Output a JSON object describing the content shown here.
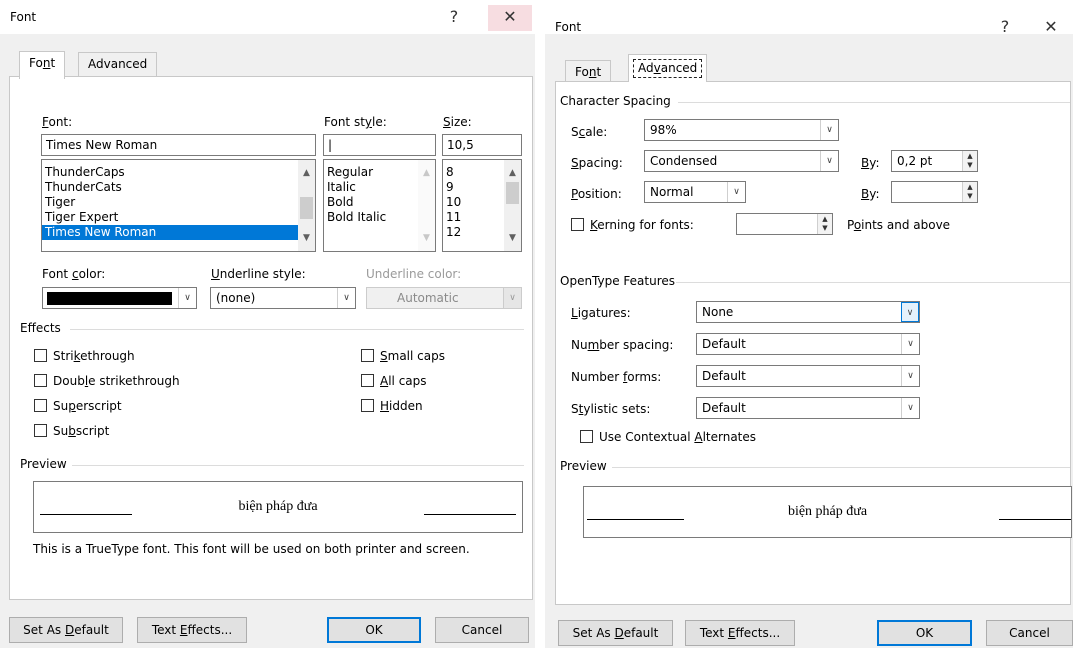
{
  "left_dialog": {
    "title": "Font",
    "help_label": "?",
    "close_label": "✕",
    "tabs": [
      {
        "prefix": "Fo",
        "mnemonic": "n",
        "suffix": "t"
      },
      {
        "label": "Advanced"
      }
    ],
    "font_label": {
      "mnemonic": "F",
      "rest": "ont:"
    },
    "font_value": "Times New Roman",
    "font_list": [
      "ThunderCaps",
      "ThunderCats",
      "Tiger",
      "Tiger Expert",
      "Times New Roman"
    ],
    "style_label": {
      "prefix": "Font st",
      "mnemonic": "y",
      "suffix": "le:"
    },
    "style_value": "|",
    "style_list": [
      "Regular",
      "Italic",
      "Bold",
      "Bold Italic"
    ],
    "size_label": {
      "mnemonic": "S",
      "rest": "ize:"
    },
    "size_value": "10,5",
    "size_list": [
      "8",
      "9",
      "10",
      "11",
      "12"
    ],
    "font_color_label": {
      "prefix": "Font ",
      "mnemonic": "c",
      "suffix": "olor:"
    },
    "font_color": "#000000",
    "underline_style_label": {
      "mnemonic": "U",
      "rest": "nderline style:"
    },
    "underline_style_value": "(none)",
    "underline_color_label": "Underline color:",
    "underline_color_value": "Automatic",
    "effects_label": "Effects",
    "effects": [
      {
        "prefix": "Stri",
        "mnemonic": "k",
        "suffix": "ethrough",
        "checked": false
      },
      {
        "prefix": "Doub",
        "mnemonic": "l",
        "suffix": "e strikethrough",
        "checked": false
      },
      {
        "prefix": "Su",
        "mnemonic": "p",
        "suffix": "erscript",
        "checked": false
      },
      {
        "prefix": "Su",
        "mnemonic": "b",
        "suffix": "script",
        "checked": false
      },
      {
        "prefix": "",
        "mnemonic": "S",
        "suffix": "mall caps",
        "checked": false
      },
      {
        "prefix": "",
        "mnemonic": "A",
        "suffix": "ll caps",
        "checked": false
      },
      {
        "prefix": "",
        "mnemonic": "H",
        "suffix": "idden",
        "checked": false
      }
    ],
    "preview_label": "Preview",
    "preview_text": "biện pháp đưa",
    "truetype_note": "This is a TrueType font. This font will be used on both printer and screen.",
    "buttons": {
      "set_default": {
        "prefix": "Set As ",
        "mnemonic": "D",
        "suffix": "efault"
      },
      "text_effects": {
        "prefix": "Text ",
        "mnemonic": "E",
        "suffix": "ffects..."
      },
      "ok": "OK",
      "cancel": "Cancel"
    }
  },
  "right_dialog": {
    "title": "Font",
    "help_label": "?",
    "close_label": "✕",
    "tabs": [
      {
        "prefix": "Fo",
        "mnemonic": "n",
        "suffix": "t"
      },
      {
        "prefix": "Ad",
        "mnemonic": "v",
        "suffix": "anced"
      }
    ],
    "character_spacing_label": "Character Spacing",
    "scale_label": {
      "prefix": "S",
      "mnemonic": "c",
      "suffix": "ale:"
    },
    "scale_value": "98%",
    "spacing_label": {
      "mnemonic": "S",
      "rest": "pacing:"
    },
    "spacing_value": "Condensed",
    "spacing_by_label": {
      "mnemonic": "B",
      "rest": "y:"
    },
    "spacing_by_value": "0,2 pt",
    "position_label": {
      "mnemonic": "P",
      "rest": "osition:"
    },
    "position_value": "Normal",
    "position_by_label": {
      "mnemonic": "B",
      "rest": "y:"
    },
    "position_by_value": "",
    "kerning_label": {
      "mnemonic": "K",
      "rest": "erning for fonts:"
    },
    "kerning_value": "",
    "points_label": {
      "prefix": "P",
      "mnemonic": "o",
      "suffix": "ints and above"
    },
    "opentype_label": "OpenType Features",
    "ligatures_label": {
      "mnemonic": "L",
      "rest": "igatures:"
    },
    "ligatures_value": "None",
    "number_spacing_label": {
      "prefix": "Nu",
      "mnemonic": "m",
      "suffix": "ber spacing:"
    },
    "number_spacing_value": "Default",
    "number_forms_label": {
      "prefix": "Number ",
      "mnemonic": "f",
      "suffix": "orms:"
    },
    "number_forms_value": "Default",
    "stylistic_sets_label": {
      "prefix": "S",
      "mnemonic": "t",
      "suffix": "ylistic sets:"
    },
    "stylistic_sets_value": "Default",
    "contextual_label": {
      "prefix": "Use Contextual ",
      "mnemonic": "A",
      "suffix": "lternates"
    },
    "preview_label": "Preview",
    "preview_text": "biện pháp đưa",
    "buttons": {
      "set_default": {
        "prefix": "Set As ",
        "mnemonic": "D",
        "suffix": "efault"
      },
      "text_effects": {
        "prefix": "Text ",
        "mnemonic": "E",
        "suffix": "ffects..."
      },
      "ok": "OK",
      "cancel": "Cancel"
    }
  },
  "icons": {
    "dropdown_arrow": "chevron-down-icon",
    "scroll_up": "triangle-up-icon",
    "scroll_down": "triangle-down-icon",
    "spin": "spin-updown-icon"
  },
  "colors": {
    "selection": "#0078d7",
    "dialog_bg": "#f0f0f0",
    "close_hover": "#f7dde1"
  }
}
